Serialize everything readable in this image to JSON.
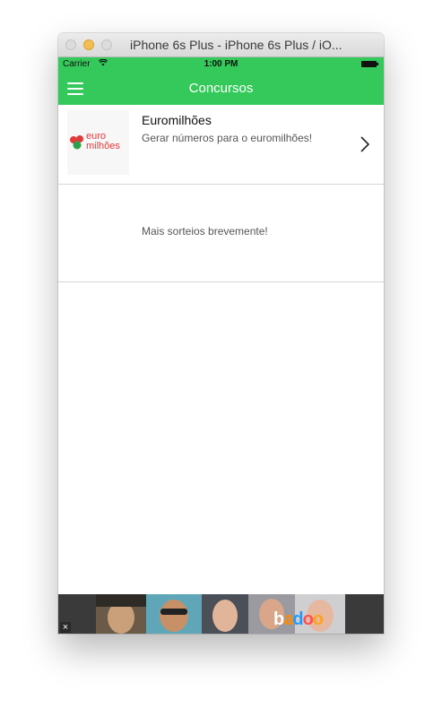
{
  "window": {
    "title": "iPhone 6s Plus - iPhone 6s Plus / iO..."
  },
  "status_bar": {
    "carrier": "Carrier",
    "time": "1:00 PM"
  },
  "nav": {
    "title": "Concursos",
    "menu_icon": "hamburger-menu-icon"
  },
  "list": {
    "items": [
      {
        "logo_line1": "euro",
        "logo_line2": "milhões",
        "title": "Euromilhões",
        "subtitle": "Gerar números para o euromilhões!",
        "icon": "chevron-right-icon"
      },
      {
        "message": "Mais sorteios brevemente!"
      }
    ]
  },
  "ad_banner": {
    "close_label": "×",
    "brand": [
      "b",
      "a",
      "d",
      "o",
      "o"
    ],
    "brand_colors": [
      "#ffffff",
      "#ff8a00",
      "#1e9bff",
      "#ff5050",
      "#ffa21c"
    ],
    "accent": "#34c95a"
  }
}
